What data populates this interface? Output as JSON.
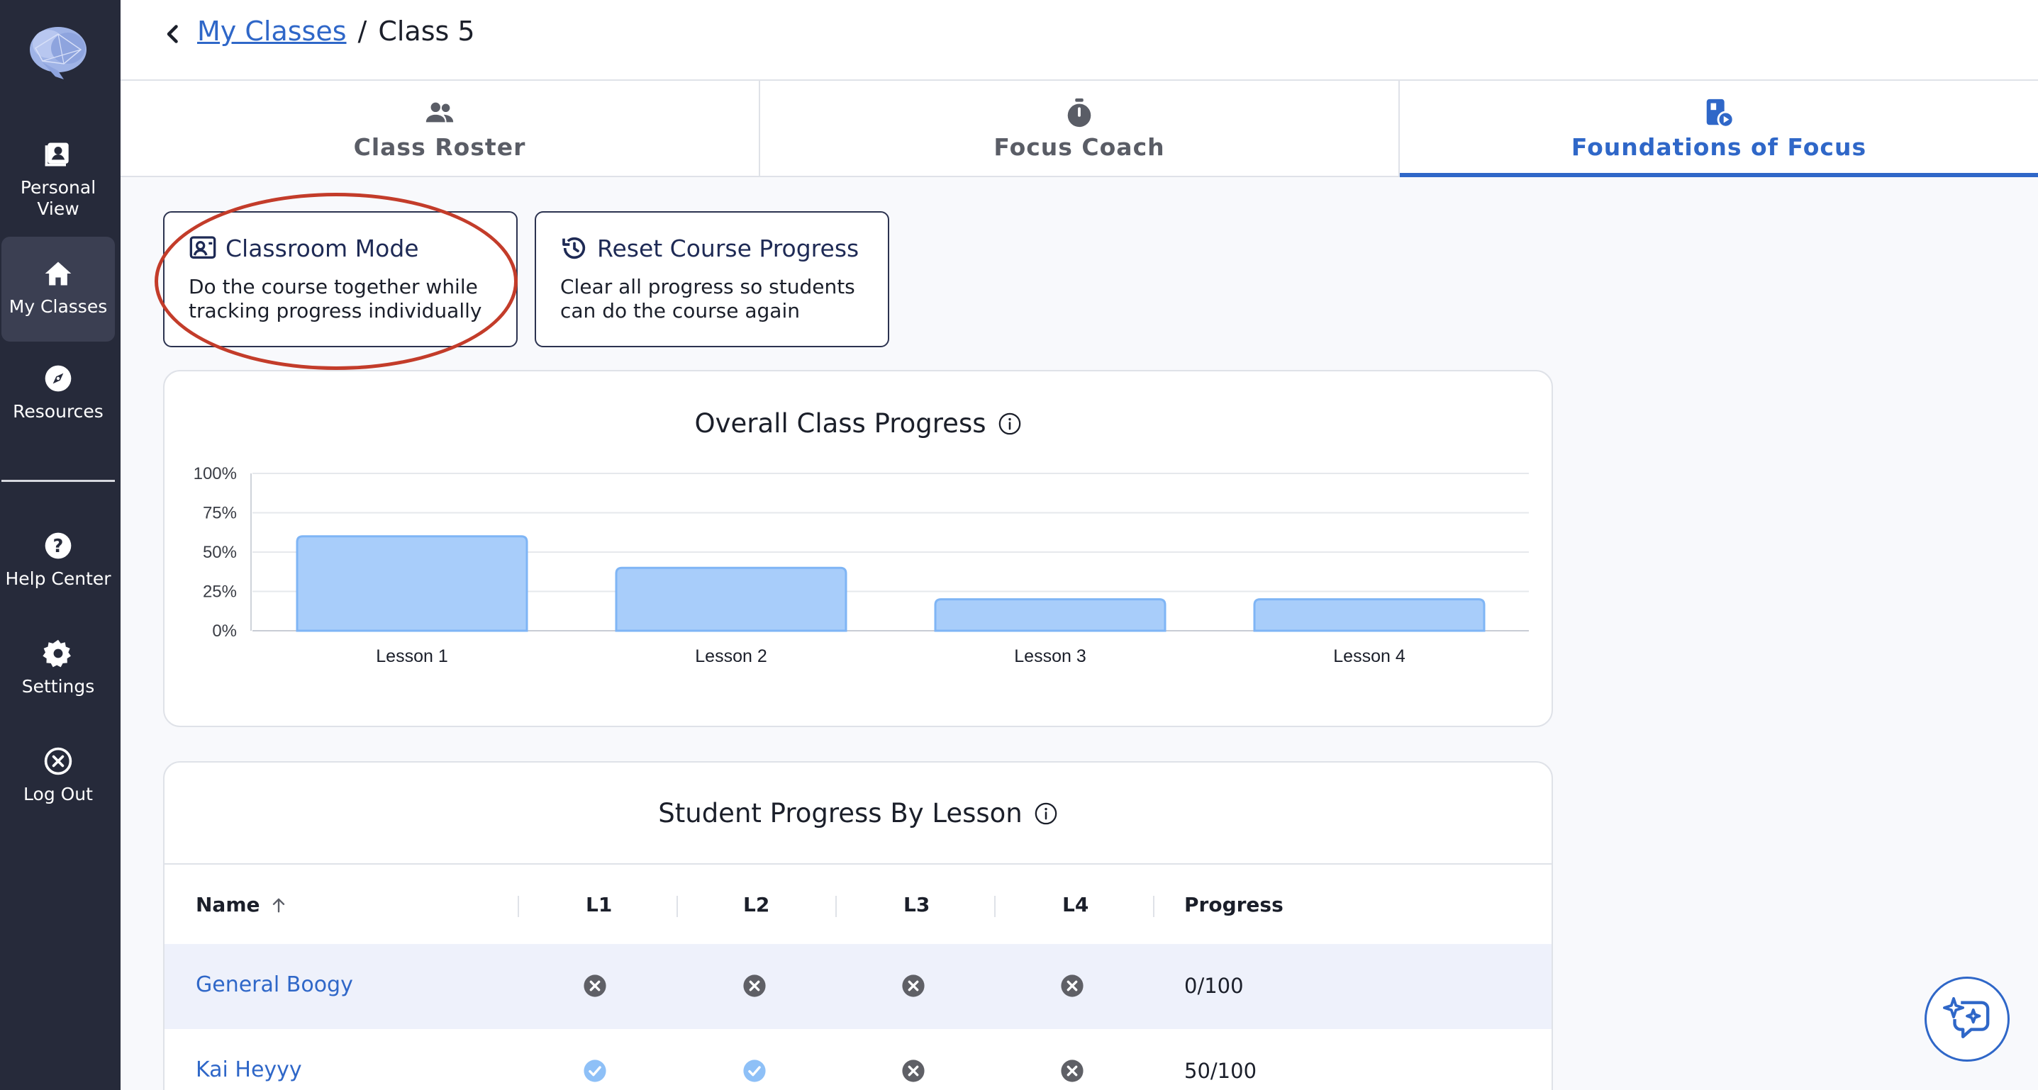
{
  "sidebar": {
    "items": [
      {
        "label": "Personal View",
        "icon": "personal-view-icon"
      },
      {
        "label": "My Classes",
        "icon": "home-icon",
        "active": true
      },
      {
        "label": "Resources",
        "icon": "compass-icon"
      },
      {
        "label": "Help Center",
        "icon": "help-icon"
      },
      {
        "label": "Settings",
        "icon": "gear-icon"
      },
      {
        "label": "Log Out",
        "icon": "close-circle-icon"
      }
    ]
  },
  "breadcrumb": {
    "link": "My Classes",
    "separator": "/",
    "current": "Class 5"
  },
  "tabs": [
    {
      "label": "Class Roster",
      "icon": "people-icon"
    },
    {
      "label": "Focus Coach",
      "icon": "stopwatch-icon"
    },
    {
      "label": "Foundations of Focus",
      "icon": "course-icon",
      "active": true
    }
  ],
  "actions": {
    "classroom_mode": {
      "title": "Classroom Mode",
      "description_line1": "Do the course together while",
      "description_line2": "tracking progress individually"
    },
    "reset_progress": {
      "title": "Reset Course Progress",
      "description_line1": "Clear all progress so students",
      "description_line2": "can do the course again"
    }
  },
  "overall": {
    "title": "Overall Class Progress"
  },
  "chart_data": {
    "type": "bar",
    "title": "Overall Class Progress",
    "categories": [
      "Lesson 1",
      "Lesson 2",
      "Lesson 3",
      "Lesson 4"
    ],
    "values": [
      60,
      40,
      20,
      20
    ],
    "yticks": [
      "0%",
      "25%",
      "50%",
      "75%",
      "100%"
    ],
    "ylim": [
      0,
      100
    ],
    "xlabel": "",
    "ylabel": "",
    "grid": true,
    "bar_color": "#a8cdfa",
    "bar_border": "#7fb5f5"
  },
  "student_table": {
    "title": "Student Progress By Lesson",
    "columns": [
      "Name",
      "L1",
      "L2",
      "L3",
      "L4",
      "Progress"
    ],
    "rows": [
      {
        "name": "General Boogy",
        "lessons": [
          "incomplete",
          "incomplete",
          "incomplete",
          "incomplete"
        ],
        "progress": "0/100"
      },
      {
        "name": "Kai Heyyy",
        "lessons": [
          "complete",
          "complete",
          "incomplete",
          "incomplete"
        ],
        "progress": "50/100"
      }
    ]
  },
  "colors": {
    "accent": "#2f67c8",
    "sidebar": "#262a3a",
    "annotation": "#c33c2a"
  }
}
